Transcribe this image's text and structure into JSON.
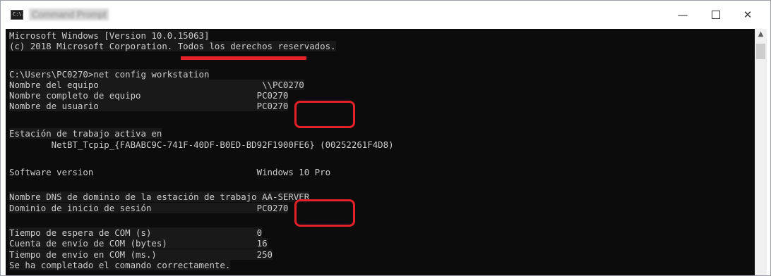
{
  "window": {
    "title": "Command Prompt",
    "icon_label": "C:\\.",
    "controls": {
      "minimize": "—",
      "maximize": "",
      "close": "✕"
    }
  },
  "console": {
    "lines": [
      "Microsoft Windows [Version 10.0.15063]",
      "(c) 2018 Microsoft Corporation. Todos los derechos reservados.",
      "",
      "C:\\Users\\PC0270>net config workstation",
      "Nombre del equipo                               \\\\PC0270",
      "Nombre completo de equipo                      PC0270",
      "Nombre de usuario                              PC0270",
      "",
      "Estación de trabajo activa en",
      "        NetBT_Tcpip_{FABABC9C-741F-40DF-B0ED-BD92F1900FE6} (00252261F4D8)",
      "",
      "Software version                               Windows 10 Pro",
      "",
      "Nombre DNS de dominio de la estación de trabajo AA-SERVER",
      "Dominio de inicio de sesión                    PC0270",
      "",
      "Tiempo de espera de COM (s)                    0",
      "Cuenta de envío de COM (bytes)                 16",
      "Tiempo de envío en COM (ms.)                   250",
      "Se ha completado el comando correctamente."
    ]
  },
  "annotations": {
    "redaction_color": "#e4202a",
    "highlight_color": "#e4202a"
  },
  "scrollbar": {
    "up_arrow": "▲"
  }
}
